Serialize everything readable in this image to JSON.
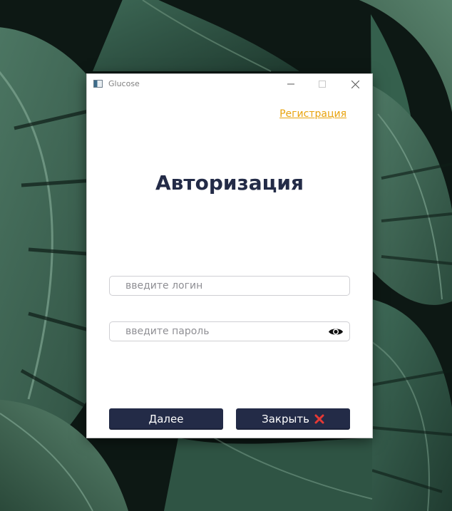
{
  "window": {
    "title": "Glucose",
    "controls": {
      "minimize_icon": "minimize-icon",
      "maximize_icon": "maximize-icon",
      "close_icon": "close-icon"
    }
  },
  "header": {
    "register_link": "Регистрация"
  },
  "main": {
    "title": "Авторизация",
    "login_placeholder": "введите логин",
    "login_value": "",
    "password_placeholder": "введите пароль",
    "password_value": "",
    "show_password_icon": "eye-icon"
  },
  "actions": {
    "next_label": "Далее",
    "close_label": "Закрыть",
    "close_icon": "red-cross-icon"
  },
  "colors": {
    "accent": "#232b47",
    "link": "#e8a30e",
    "close_cross": "#e53935",
    "background_foliage": "#2f5a48"
  }
}
